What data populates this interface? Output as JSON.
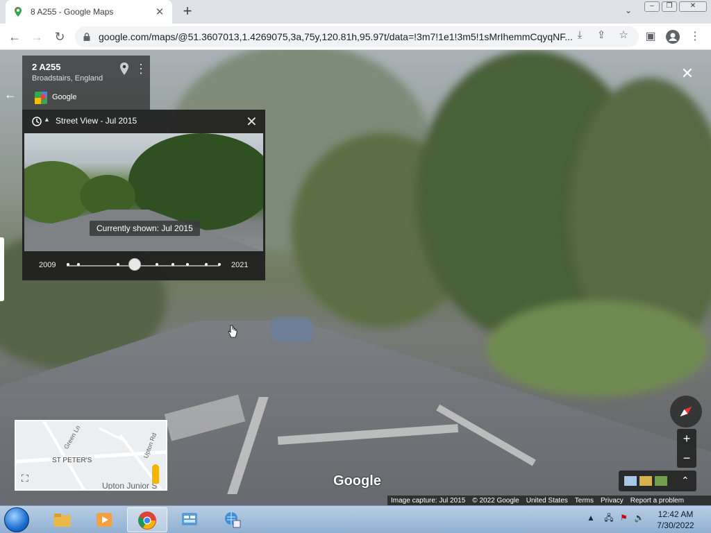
{
  "browser": {
    "tab_title": "8 A255 - Google Maps",
    "url": "google.com/maps/@51.3607013,1.4269075,3a,75y,120.81h,95.97t/data=!3m7!1e1!3m5!1sMrIhemmCqyqNF...",
    "window_buttons": [
      "–",
      "❐",
      "✕"
    ]
  },
  "place_card": {
    "name": "2 A255",
    "subtitle": "Broadstairs, England",
    "source": "Google"
  },
  "time_machine": {
    "title": "Street View - Jul 2015",
    "tooltip": "Currently shown: Jul 2015",
    "start_year": "2009",
    "end_year": "2021"
  },
  "minimap": {
    "labels": [
      "Green Ln",
      "Upton Rd",
      "ST PETER'S"
    ],
    "bottom_label": "Upton Junior S"
  },
  "watermark": "Google",
  "footer": {
    "items": [
      "Image capture: Jul 2015",
      "© 2022 Google",
      "United States",
      "Terms",
      "Privacy",
      "Report a problem"
    ]
  },
  "zoom": {
    "in": "+",
    "out": "−"
  },
  "taskbar": {
    "time": "12:42 AM",
    "date": "7/30/2022"
  },
  "colors": {
    "chrome_accent": "#1a73e8",
    "panel_bg": "#1e1e1e",
    "taskbar": "#8fb0d3"
  }
}
